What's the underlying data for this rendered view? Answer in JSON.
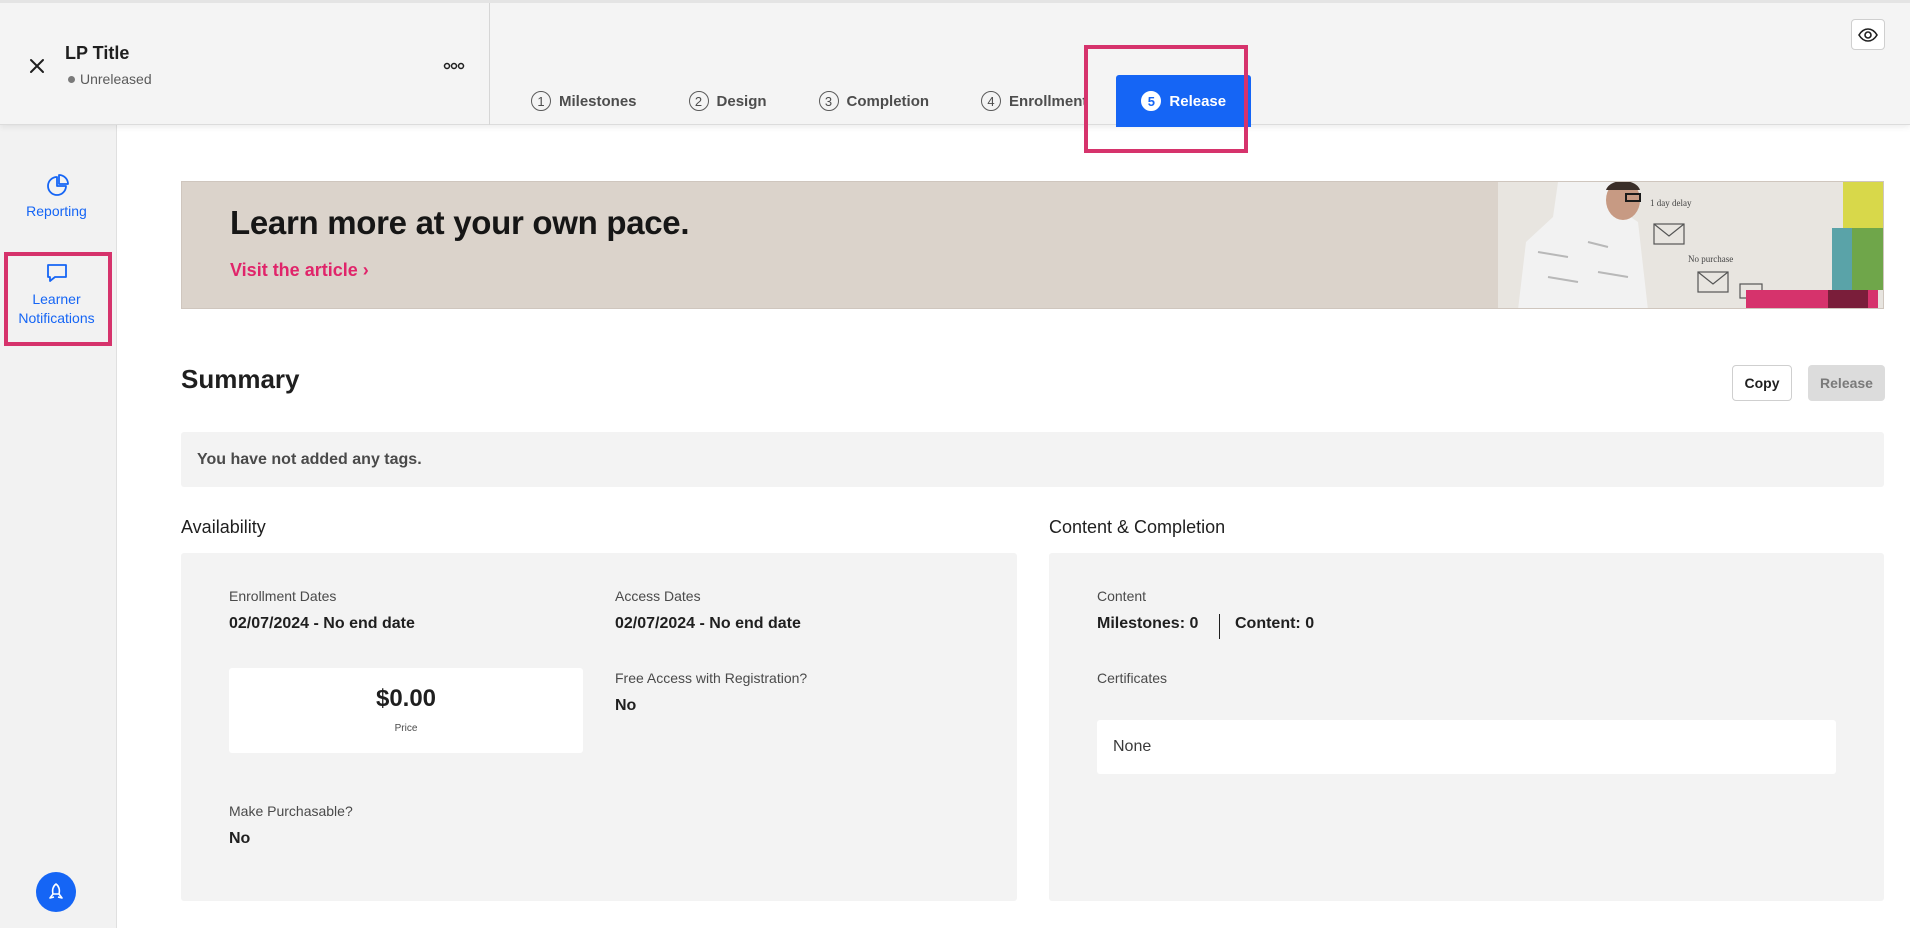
{
  "header": {
    "title": "LP Title",
    "status": "Unreleased",
    "tabs": [
      {
        "num": "1",
        "label": "Milestones"
      },
      {
        "num": "2",
        "label": "Design"
      },
      {
        "num": "3",
        "label": "Completion"
      },
      {
        "num": "4",
        "label": "Enrollment"
      },
      {
        "num": "5",
        "label": "Release"
      }
    ],
    "active_tab": "Release"
  },
  "sidebar": {
    "items": [
      {
        "label": "Reporting",
        "icon": "pie-chart-icon"
      },
      {
        "label_line1": "Learner",
        "label_line2": "Notifications",
        "icon": "chat-bubble-icon"
      }
    ]
  },
  "banner": {
    "headline": "Learn more at your own pace.",
    "link": "Visit the article ›"
  },
  "summary": {
    "title": "Summary",
    "copy_label": "Copy",
    "release_label": "Release",
    "tags_message": "You have not added any tags."
  },
  "availability": {
    "section": "Availability",
    "enrollment_label": "Enrollment Dates",
    "enrollment_value": "02/07/2024 - No end date",
    "access_label": "Access Dates",
    "access_value": "02/07/2024 - No end date",
    "price_value": "$0.00",
    "price_label": "Price",
    "free_access_label": "Free Access with Registration?",
    "free_access_value": "No",
    "purchasable_label": "Make Purchasable?",
    "purchasable_value": "No"
  },
  "content_completion": {
    "section": "Content & Completion",
    "content_label": "Content",
    "milestones_count": "Milestones: 0",
    "content_count": "Content: 0",
    "certificates_label": "Certificates",
    "certificates_value": "None"
  },
  "colors": {
    "accent": "#1565f5",
    "highlight": "#d6336c",
    "link": "#e0246a"
  }
}
